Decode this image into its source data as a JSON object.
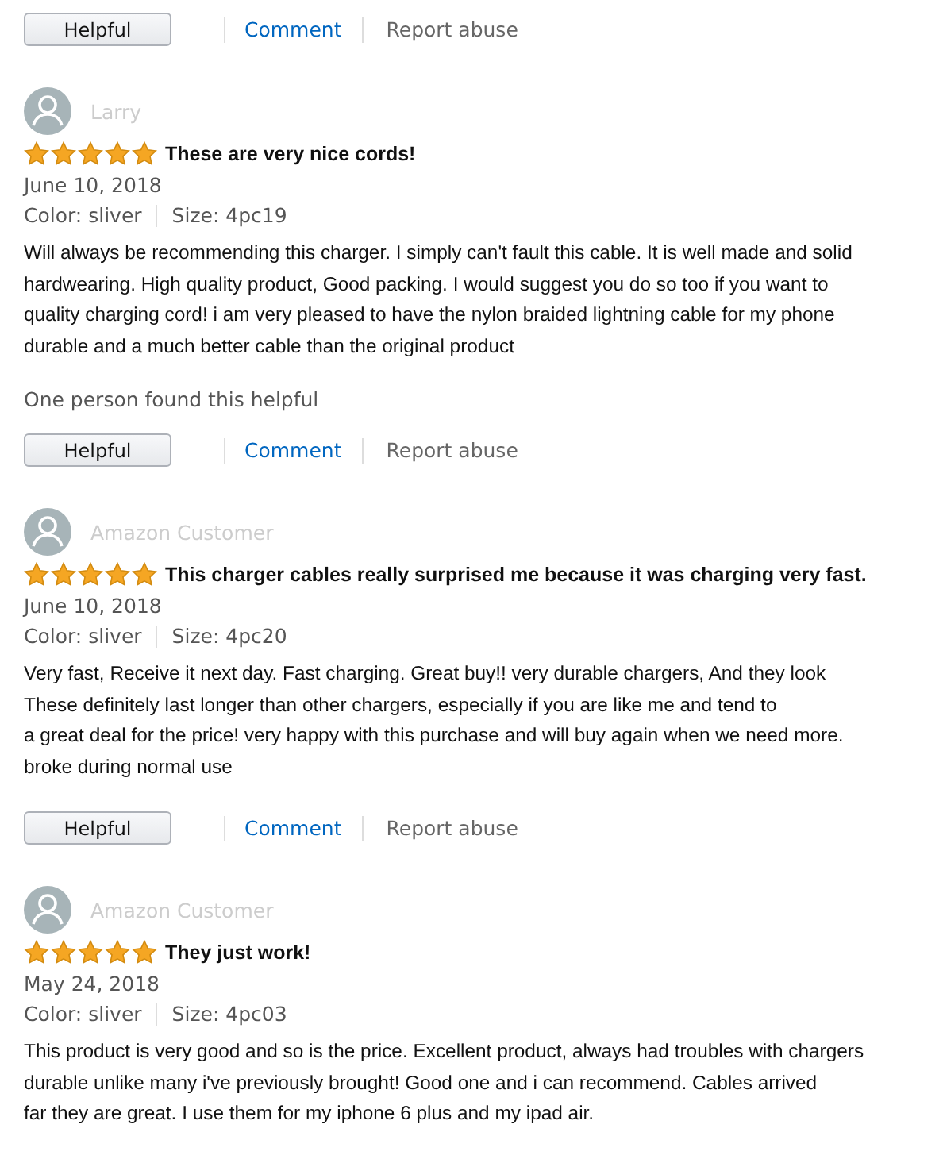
{
  "top_actions": {
    "helpful_button": "Helpful",
    "comment_link": "Comment",
    "report_link": "Report abuse"
  },
  "reviews": [
    {
      "reviewer": "Larry",
      "stars": 5,
      "title": "These are very nice cords!",
      "date": "June 10, 2018",
      "color_option": "Color: sliver",
      "size_option": "Size: 4pc19",
      "body_lines": [
        "Will always be recommending this charger. I simply can't fault this cable. It is well made and solid",
        "hardwearing. High quality product, Good packing. I would suggest you do so too if you want to",
        "quality charging cord! i am very pleased to have the nylon braided lightning cable for my phone",
        "durable and a much better cable than the original product"
      ],
      "helpful_note": "One person found this helpful",
      "actions": {
        "helpful_button": "Helpful",
        "comment_link": "Comment",
        "report_link": "Report abuse"
      }
    },
    {
      "reviewer": "Amazon Customer",
      "stars": 5,
      "title": "This charger cables really surprised me because it was charging very fast.",
      "date": "June 10, 2018",
      "color_option": "Color: sliver",
      "size_option": "Size: 4pc20",
      "body_lines": [
        "Very fast, Receive it next day. Fast charging. Great buy!! very durable chargers, And they look",
        "These definitely last longer than other chargers, especially if you are like me and tend to",
        "a great deal for the price! very happy with this purchase and will buy again when we need more.",
        "broke during normal use"
      ],
      "actions": {
        "helpful_button": "Helpful",
        "comment_link": "Comment",
        "report_link": "Report abuse"
      }
    },
    {
      "reviewer": "Amazon Customer",
      "stars": 5,
      "title": "They just work!",
      "date": "May 24, 2018",
      "color_option": "Color: sliver",
      "size_option": "Size: 4pc03",
      "body_lines": [
        "This product is very good and so is the price. Excellent product, always had troubles with chargers",
        "durable unlike many i've previously brought! Good one and i can recommend. Cables arrived",
        "far they are great. I use them for my iphone 6 plus and my ipad air."
      ]
    }
  ]
}
